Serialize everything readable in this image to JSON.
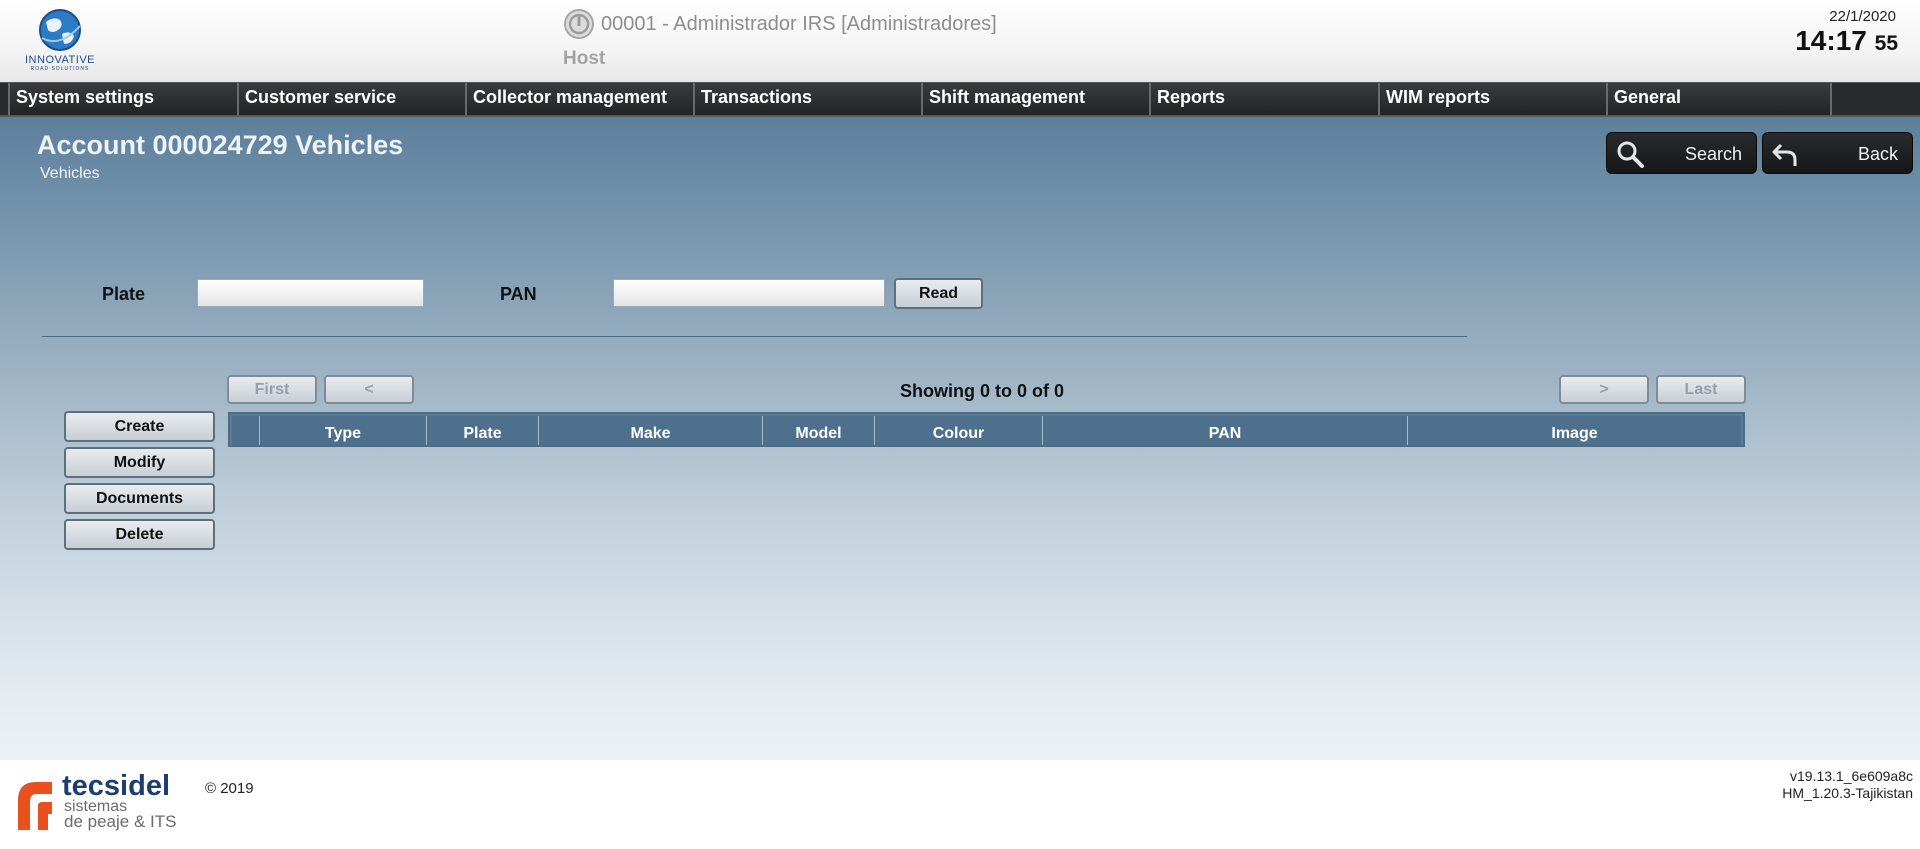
{
  "header": {
    "logo_text": "INNOVATIVE",
    "logo_subtext": "ROAD SOLUTIONS",
    "user": "00001 - Administrador IRS [Administradores]",
    "host": "Host",
    "date": "22/1/2020",
    "time": "14:17",
    "seconds": "55"
  },
  "menu": {
    "items": [
      {
        "label": "System settings"
      },
      {
        "label": "Customer service"
      },
      {
        "label": "Collector management"
      },
      {
        "label": "Transactions"
      },
      {
        "label": "Shift management"
      },
      {
        "label": "Reports"
      },
      {
        "label": "WIM reports"
      },
      {
        "label": "General"
      }
    ]
  },
  "page": {
    "title": "Account 000024729 Vehicles",
    "subtitle": "Vehicles"
  },
  "toolbar": {
    "search_label": "Search",
    "back_label": "Back"
  },
  "filter": {
    "plate_label": "Plate",
    "plate_value": "",
    "pan_label": "PAN",
    "pan_value": "",
    "read_label": "Read"
  },
  "pagination": {
    "first": "First",
    "prev": "<",
    "next": ">",
    "last": "Last",
    "showing": "Showing 0 to 0 of 0"
  },
  "actions": {
    "create": "Create",
    "modify": "Modify",
    "documents": "Documents",
    "delete": "Delete"
  },
  "table": {
    "columns": [
      "",
      "Type",
      "Plate",
      "Make",
      "Model",
      "Colour",
      "PAN",
      "Image"
    ],
    "rows": []
  },
  "footer": {
    "brand": "tecsidel",
    "brand_sub1": "sistemas",
    "brand_sub2": "de peaje & ITS",
    "copyright": "© 2019",
    "version1": "v19.13.1_6e609a8c",
    "version2": "HM_1.20.3-Tajikistan"
  },
  "colors": {
    "menu_bg": "#2a2b2d",
    "table_header": "#4f708c",
    "brand_orange": "#e8501e",
    "brand_navy": "#1b3d6f"
  }
}
